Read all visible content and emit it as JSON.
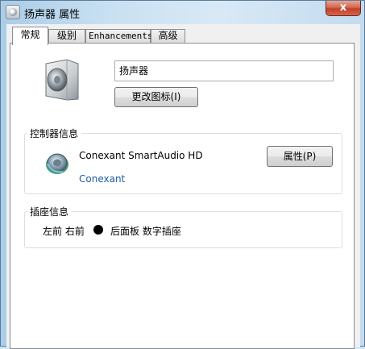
{
  "window": {
    "title": "扬声器 属性",
    "close_label": "x"
  },
  "tabs": [
    {
      "label": "常规",
      "active": true
    },
    {
      "label": "级别",
      "active": false
    },
    {
      "label": "Enhancements",
      "active": false
    },
    {
      "label": "高级",
      "active": false
    }
  ],
  "general": {
    "device_name": "扬声器",
    "change_icon_button": "更改图标(I)",
    "controller_group": {
      "label": "控制器信息",
      "controller_name": "Conexant SmartAudio HD",
      "vendor_link": "Conexant",
      "properties_button": "属性(P)"
    },
    "jack_group": {
      "label": "插座信息",
      "front_channels": "左前 右前",
      "jack_color": "#000000",
      "jack_location": "后面板 数字插座"
    }
  },
  "icons": [
    "speaker-icon",
    "audio-device-icon",
    "jack-color-dot"
  ],
  "colors": {
    "link": "#1a5ea6",
    "close_button": "#c1402a"
  }
}
